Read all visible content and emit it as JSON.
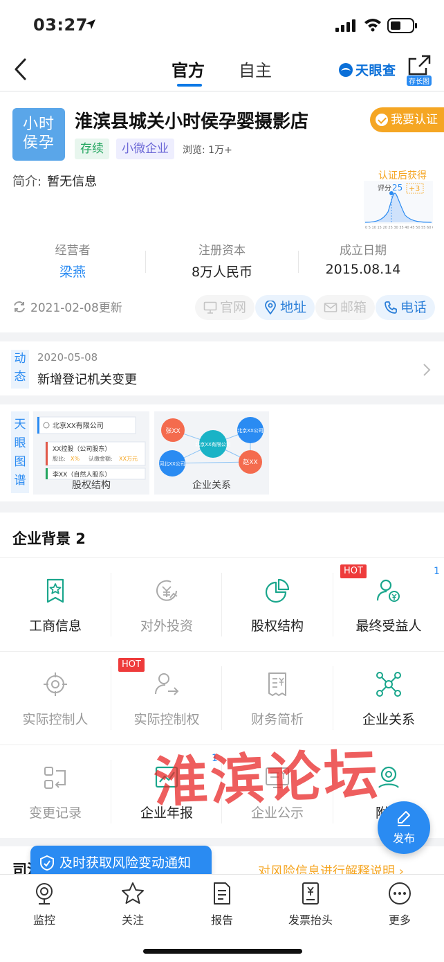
{
  "status_bar": {
    "time": "03:27"
  },
  "nav": {
    "tabs": [
      {
        "label": "官方",
        "active": true
      },
      {
        "label": "自主",
        "active": false
      }
    ],
    "brand": "天眼查",
    "share_label": "存长图"
  },
  "company": {
    "logo_line1": "小时",
    "logo_line2": "侯孕",
    "name": "淮滨县城关小时侯孕婴摄影店",
    "certify_button": "我要认证",
    "tags": [
      "存续",
      "小微企业"
    ],
    "views": "浏览: 1万+",
    "intro_label": "简介:",
    "intro_value": "暂无信息",
    "score": {
      "caption": "认证后获得",
      "label": "评分",
      "value": "25",
      "bonus": "+3"
    },
    "stats": [
      {
        "label": "经营者",
        "value": "梁燕"
      },
      {
        "label": "注册资本",
        "value": "8万人民币"
      },
      {
        "label": "成立日期",
        "value": "2015.08.14"
      }
    ],
    "updated": "2021-02-08更新",
    "actions": [
      {
        "label": "官网",
        "enabled": false,
        "icon": "monitor-icon"
      },
      {
        "label": "地址",
        "enabled": true,
        "icon": "location-icon"
      },
      {
        "label": "邮箱",
        "enabled": false,
        "icon": "mail-icon"
      },
      {
        "label": "电话",
        "enabled": true,
        "icon": "phone-icon"
      }
    ]
  },
  "dynamics": {
    "label": "动态",
    "date": "2020-05-08",
    "text": "新增登记机关变更"
  },
  "atlas": {
    "label": "天眼图谱",
    "equity": {
      "caption": "股权结构",
      "company": "北京XX有限公司",
      "holder1": "XX控股（公司股东）",
      "holder1_ratio_label": "股比:",
      "holder1_ratio": "X%",
      "holder1_amount_label": "认缴金额:",
      "holder1_amount": "XX万元",
      "holder2": "李XX（自然人股东）"
    },
    "relation": {
      "caption": "企业关系",
      "nodes": [
        "张XX",
        "北京XX有限公司",
        "北京XX公司",
        "河北XX公司",
        "赵XX"
      ]
    }
  },
  "background": {
    "title": "企业背景 2",
    "items": [
      {
        "label": "工商信息",
        "icon": "id-card-star-icon",
        "active": true
      },
      {
        "label": "对外投资",
        "icon": "investment-icon",
        "active": false
      },
      {
        "label": "股权结构",
        "icon": "pie-chart-icon",
        "active": true
      },
      {
        "label": "最终受益人",
        "icon": "beneficiary-icon",
        "active": true,
        "hot": "HOT",
        "count": "1"
      },
      {
        "label": "实际控制人",
        "icon": "target-icon",
        "active": false
      },
      {
        "label": "实际控制权",
        "icon": "control-icon",
        "active": false,
        "hot": "HOT"
      },
      {
        "label": "财务简析",
        "icon": "finance-doc-icon",
        "active": false
      },
      {
        "label": "企业关系",
        "icon": "network-icon",
        "active": true
      },
      {
        "label": "变更记录",
        "icon": "change-record-icon",
        "active": false
      },
      {
        "label": "企业年报",
        "icon": "annual-report-icon",
        "active": true,
        "count": "1"
      },
      {
        "label": "企业公示",
        "icon": "announcement-icon",
        "active": false
      },
      {
        "label": "附近",
        "icon": "nearby-icon",
        "active": true
      }
    ]
  },
  "risk": {
    "title": "司法风险",
    "explain": "对风险信息进行解释说明"
  },
  "toast": "及时获取风险变动通知",
  "fab_label": "发布",
  "watermark": "淮滨论坛",
  "tabbar": [
    {
      "label": "监控",
      "icon": "monitor-camera-icon"
    },
    {
      "label": "关注",
      "icon": "star-icon"
    },
    {
      "label": "报告",
      "icon": "report-icon"
    },
    {
      "label": "发票抬头",
      "icon": "invoice-icon"
    },
    {
      "label": "更多",
      "icon": "more-icon"
    }
  ],
  "colors": {
    "accent": "#2a8bf2",
    "warning": "#f5a623",
    "success": "#24a660",
    "hot": "#ee3b3b",
    "watermark": "#e82828"
  }
}
